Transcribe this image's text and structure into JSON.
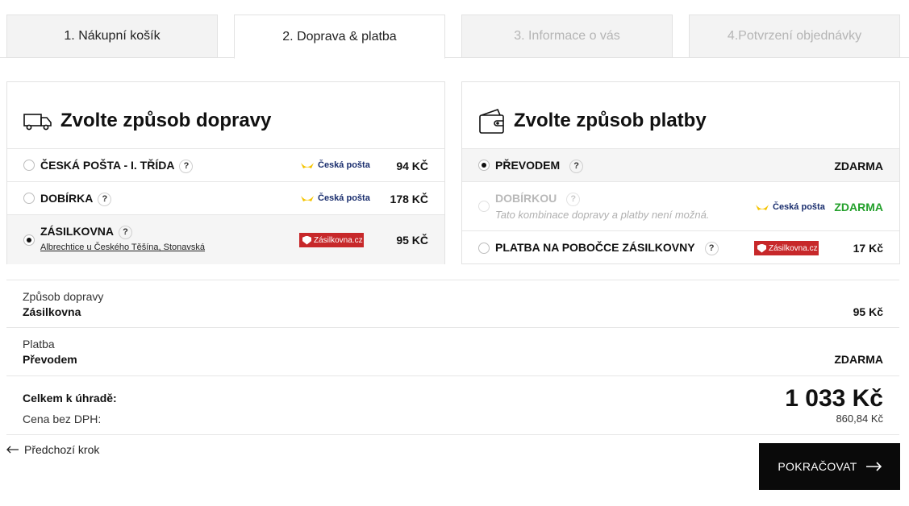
{
  "tabs": [
    {
      "label": "1. Nákupní košík",
      "state": "normal"
    },
    {
      "label": "2. Doprava & platba",
      "state": "active"
    },
    {
      "label": "3. Informace o vás",
      "state": "disabled"
    },
    {
      "label": "4.Potvrzení objednávky",
      "state": "disabled"
    }
  ],
  "shipping": {
    "title": "Zvolte způsob dopravy",
    "icon": "truck-icon",
    "options": [
      {
        "label": "ČESKÁ POŠTA - I. TŘÍDA",
        "help": "?",
        "logo": "Česká pošta",
        "price": "94 KČ",
        "selected": false
      },
      {
        "label": "DOBÍRKA",
        "help": "?",
        "logo": "Česká pošta",
        "price": "178 KČ",
        "selected": false
      },
      {
        "label": "ZÁSILKOVNA",
        "help": "?",
        "sub": "Albrechtice u Českého Těšína, Stonavská",
        "logo": "Zásilkovna.cz",
        "price": "95 KČ",
        "selected": true
      }
    ]
  },
  "payment": {
    "title": "Zvolte způsob platby",
    "icon": "wallet-icon",
    "options": [
      {
        "label": "PŘEVODEM",
        "help": "?",
        "price": "ZDARMA",
        "selected": true
      },
      {
        "label": "DOBÍRKOU",
        "help": "?",
        "note": "Tato kombinace dopravy a platby není možná.",
        "logo": "Česká pošta",
        "price": "ZDARMA",
        "disabled": true
      },
      {
        "label": "PLATBA NA POBOČCE ZÁSILKOVNY",
        "help": "?",
        "logo": "Zásilkovna.cz",
        "price": "17 Kč",
        "selected": false
      }
    ]
  },
  "summary": {
    "shipping_label": "Způsob dopravy",
    "shipping_value": "Zásilkovna",
    "shipping_price": "95 Kč",
    "payment_label": "Platba",
    "payment_value": "Převodem",
    "payment_price": "ZDARMA",
    "total_label": "Celkem k úhradě:",
    "total_value": "1 033 Kč",
    "novat_label": "Cena bez DPH:",
    "novat_value": "860,84 Kč"
  },
  "nav": {
    "back_label": "Předchozí krok",
    "next_label": "POKRAČOVAT"
  },
  "colors": {
    "accent": "#0a0a0a",
    "free_green": "#23a02b",
    "zasilkovna_red": "#c7282a",
    "posta_yellow": "#f5c400"
  }
}
